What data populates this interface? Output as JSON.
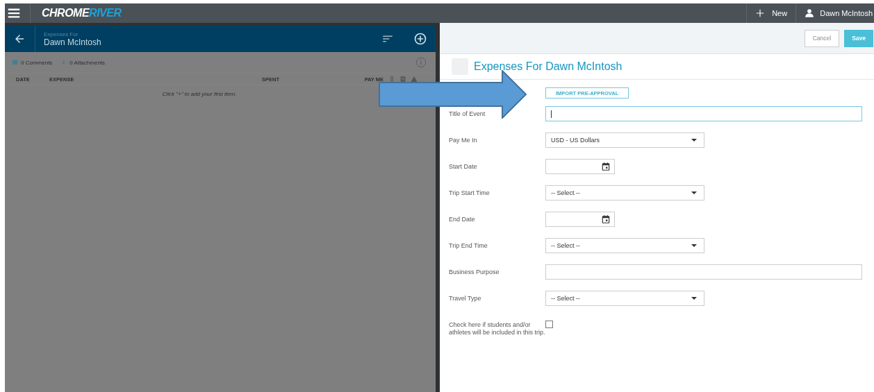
{
  "top_bar": {
    "logo": {
      "first": "CHROME",
      "second": "RIVER"
    },
    "new_button": "New",
    "user": "Dawn McIntosh"
  },
  "report_panel": {
    "subtitle": "Expenses For",
    "title": "Dawn McIntosh",
    "comments": "0 Comments",
    "attachments": "0 Attachments",
    "columns": [
      "DATE",
      "EXPENSE",
      "SPENT",
      "PAY ME"
    ],
    "empty_message": "Click \"+\" to add your first item."
  },
  "form": {
    "cancel": "Cancel",
    "save": "Save",
    "title": "Expenses For Dawn McIntosh",
    "import_button": "IMPORT PRE-APPROVAL",
    "fields": [
      {
        "kind": "text",
        "label": "Title of Event",
        "focused": true
      },
      {
        "kind": "select",
        "label": "Pay Me In",
        "value": "USD - US Dollars"
      },
      {
        "kind": "date",
        "label": "Start Date"
      },
      {
        "kind": "select",
        "label": "Trip Start Time",
        "value": "-- Select --"
      },
      {
        "kind": "date",
        "label": "End Date"
      },
      {
        "kind": "select",
        "label": "Trip End Time",
        "value": "-- Select --"
      },
      {
        "kind": "text",
        "label": "Business Purpose",
        "focused": false
      },
      {
        "kind": "select",
        "label": "Travel Type",
        "value": "-- Select --"
      },
      {
        "kind": "checkbox",
        "label": "Check here if students and/or athletes will be included in this trip.",
        "checked": false
      }
    ]
  }
}
